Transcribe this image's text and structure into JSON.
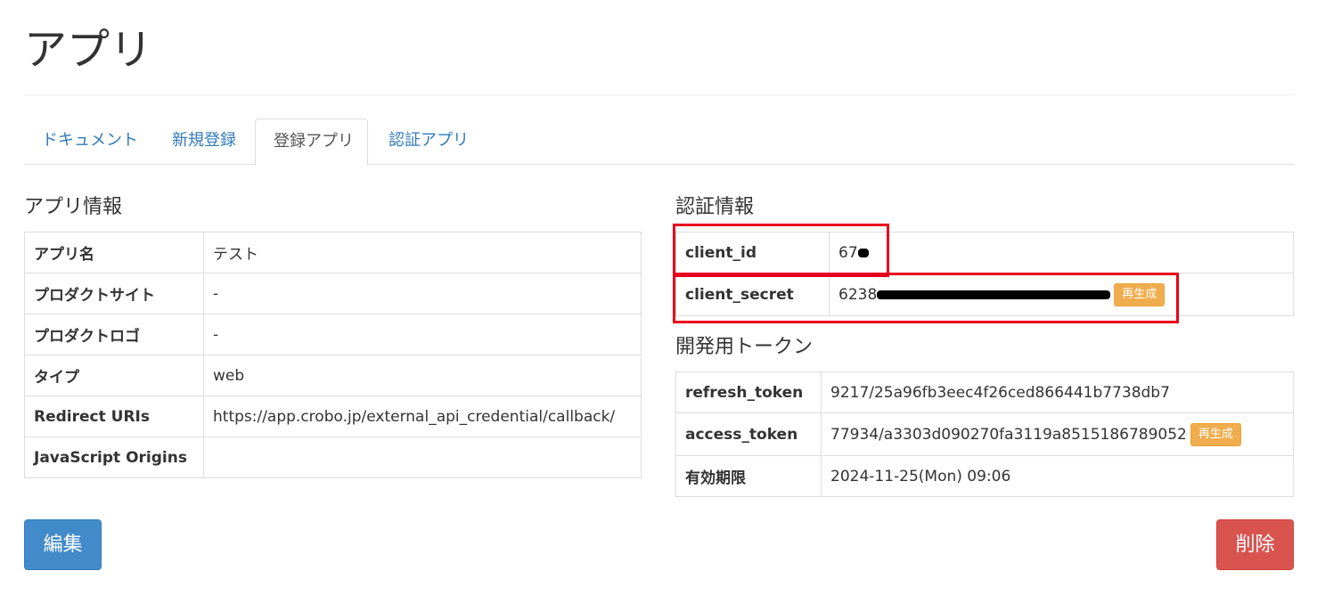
{
  "page": {
    "title": "アプリ"
  },
  "tabs": [
    {
      "label": "ドキュメント",
      "active": false
    },
    {
      "label": "新規登録",
      "active": false
    },
    {
      "label": "登録アプリ",
      "active": true
    },
    {
      "label": "認証アプリ",
      "active": false
    }
  ],
  "app_info": {
    "title": "アプリ情報",
    "rows": [
      {
        "key": "アプリ名",
        "value": "テスト"
      },
      {
        "key": "プロダクトサイト",
        "value": "-"
      },
      {
        "key": "プロダクトロゴ",
        "value": "-"
      },
      {
        "key": "タイプ",
        "value": "web"
      },
      {
        "key": "Redirect URIs",
        "value": "https://app.crobo.jp/external_api_credential/callback/"
      },
      {
        "key": "JavaScript Origins",
        "value": ""
      }
    ]
  },
  "auth_info": {
    "title": "認証情報",
    "client_id_label": "client_id",
    "client_id_value": "67",
    "client_secret_label": "client_secret",
    "client_secret_value": "6238",
    "regenerate_label": "再生成"
  },
  "dev_token": {
    "title": "開発用トークン",
    "refresh_token_label": "refresh_token",
    "refresh_token_value": "9217/25a96fb3eec4f26ced866441b7738db7",
    "access_token_label": "access_token",
    "access_token_value": "77934/a3303d090270fa3119a8515186789052",
    "regenerate_label": "再生成",
    "expiry_label": "有効期限",
    "expiry_value": "2024-11-25(Mon) 09:06"
  },
  "actions": {
    "edit_label": "編集",
    "delete_label": "削除"
  },
  "colors": {
    "link": "#337ab7",
    "primary": "#428bca",
    "danger": "#d9534f",
    "warning": "#f0ad4e",
    "annotation": "#e8001c"
  }
}
